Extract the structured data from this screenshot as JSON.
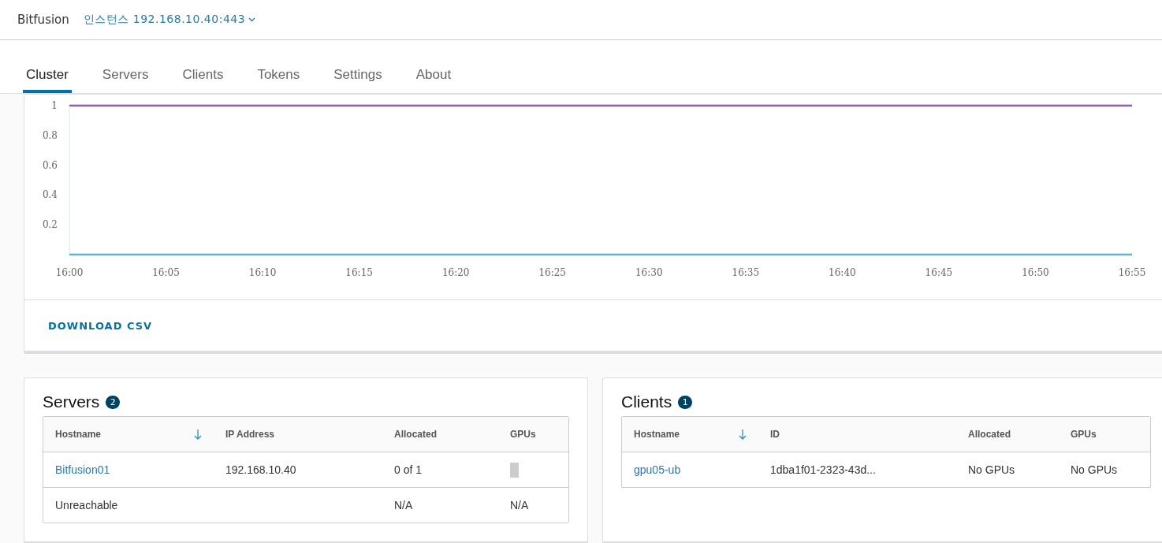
{
  "header": {
    "app_name": "Bitfusion",
    "instance": "인스턴스 192.168.10.40:443"
  },
  "tabs": [
    {
      "label": "Cluster",
      "selected": true
    },
    {
      "label": "Servers",
      "selected": false
    },
    {
      "label": "Clients",
      "selected": false
    },
    {
      "label": "Tokens",
      "selected": false
    },
    {
      "label": "Settings",
      "selected": false
    },
    {
      "label": "About",
      "selected": false
    }
  ],
  "chart_panel": {
    "chart_data": {
      "type": "line",
      "categories": [
        "16:00",
        "16:05",
        "16:10",
        "16:15",
        "16:20",
        "16:25",
        "16:30",
        "16:35",
        "16:40",
        "16:45",
        "16:50",
        "16:55"
      ],
      "ylim": [
        0,
        1
      ],
      "yticks": [
        0.2,
        0.4,
        0.6,
        0.8,
        {
          "value": 1,
          "label": "1"
        }
      ],
      "series": [
        {
          "color": "#8e5bb1",
          "values": [
            1,
            1,
            1,
            1,
            1,
            1,
            1,
            1,
            1,
            1,
            1,
            1
          ]
        },
        {
          "color": "#5fb4c9",
          "values": [
            0,
            0,
            0,
            0,
            0,
            0,
            0,
            0,
            0,
            0,
            0,
            0
          ]
        }
      ]
    },
    "action": "DOWNLOAD CSV"
  },
  "panels": [
    {
      "title": "Servers",
      "count": "2",
      "columns": [
        "Hostname",
        "IP Address",
        "Allocated",
        "GPUs"
      ],
      "rows": [
        [
          {
            "kind": "link",
            "text": "Bitfusion01"
          },
          {
            "kind": "text",
            "text": "192.168.10.40"
          },
          {
            "kind": "text",
            "text": "0 of 1"
          },
          {
            "kind": "meter",
            "level": 0
          }
        ],
        [
          {
            "kind": "text",
            "text": "Unreachable"
          },
          {
            "kind": "text",
            "text": ""
          },
          {
            "kind": "text",
            "text": "N/A"
          },
          {
            "kind": "text",
            "text": "N/A"
          }
        ]
      ]
    },
    {
      "title": "Clients",
      "count": "1",
      "columns": [
        "Hostname",
        "ID",
        "Allocated",
        "GPUs"
      ],
      "rows": [
        [
          {
            "kind": "link",
            "text": "gpu05-ub"
          },
          {
            "kind": "text",
            "text": "1dba1f01-2323-43d..."
          },
          {
            "kind": "text",
            "text": "No GPUs"
          },
          {
            "kind": "text",
            "text": "No GPUs"
          }
        ]
      ]
    }
  ]
}
